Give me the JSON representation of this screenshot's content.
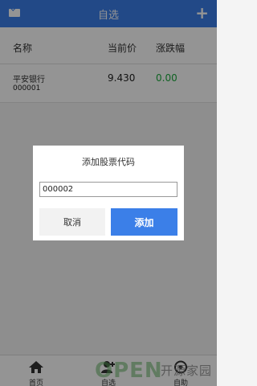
{
  "header": {
    "title": "自选",
    "left_icon": "mail-icon",
    "right_icon": "plus-icon",
    "accent_color": "#3b7fe8"
  },
  "table": {
    "columns": [
      "名称",
      "当前价",
      "涨跌幅"
    ],
    "rows": [
      {
        "name": "平安银行",
        "code": "000001",
        "price": "9.430",
        "change": "0.00",
        "change_color": "#1aaa3c"
      }
    ]
  },
  "dialog": {
    "title": "添加股票代码",
    "input_value": "000002",
    "cancel_label": "取消",
    "add_label": "添加"
  },
  "tabbar": {
    "items": [
      {
        "label": "首页",
        "icon": "home-icon"
      },
      {
        "label": "自选",
        "icon": "add-user-icon"
      },
      {
        "label": "自助",
        "icon": "settings-icon"
      }
    ]
  },
  "watermark": {
    "latin": "OPEN",
    "cn": "开源家园"
  }
}
